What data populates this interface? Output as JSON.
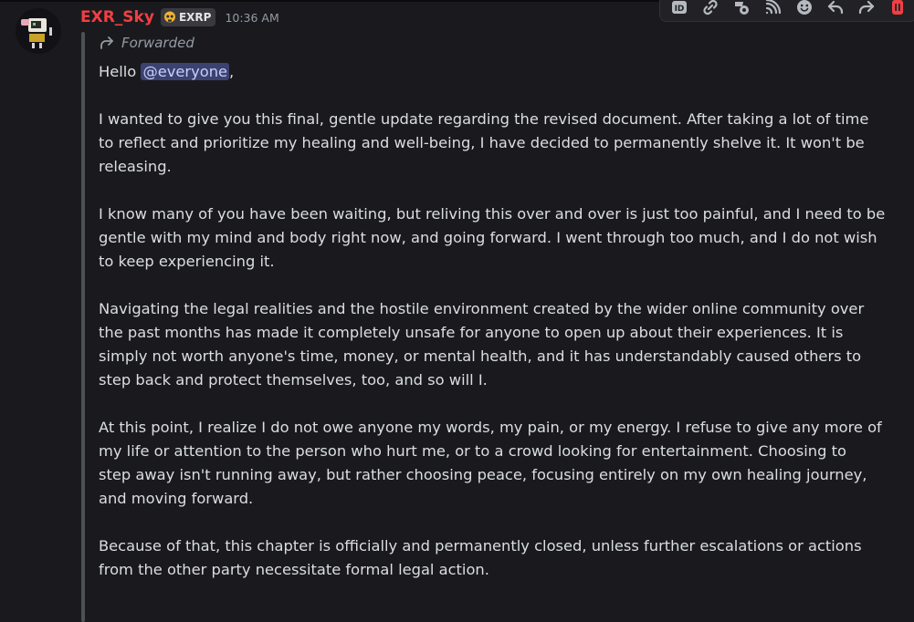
{
  "message": {
    "author": "EXR_Sky",
    "tag": "EXRP",
    "timestamp": "10:36 AM",
    "forwarded_label": "Forwarded",
    "greeting": "Hello ",
    "mention": "@everyone",
    "greeting_end": ",",
    "lines": [
      "",
      "I wanted to give you this final, gentle update regarding the revised document. After taking a lot of time",
      "to reflect and prioritize my healing and well-being, I have decided to permanently shelve it. It won't be",
      "releasing.",
      "",
      "I know many of you have been waiting, but reliving this over and over is just too painful, and I need to be",
      "gentle with my mind and body right now, and going forward. I went through too much, and I do not wish",
      "to keep experiencing it.",
      "",
      "Navigating the legal realities and the hostile environment created by the wider online community over",
      "the past months has made it completely unsafe for anyone to open up about their experiences. It is",
      "simply not worth anyone's time, money, or mental health, and it has understandably caused others to",
      "step back and protect themselves, too, and so will I.",
      "",
      "At this point, I realize I do not owe anyone my words, my pain, or my energy. I refuse to give any more of",
      "my life or attention to the person who hurt me, or to a crowd looking for entertainment. Choosing to",
      "step away isn't running away, but rather choosing peace, focusing entirely on my own healing journey,",
      "and moving forward.",
      "",
      "Because of that, this chapter is officially and permanently closed, unless further escalations or actions",
      "from the other party necessitate formal legal action."
    ]
  },
  "toolbar": {
    "icons": [
      "id-icon",
      "link-icon",
      "forward-shield-icon",
      "rss-icon",
      "add-reaction-icon",
      "reply-icon",
      "forward-icon",
      "delete-icon"
    ],
    "delete_color": "#f23f43"
  },
  "colors": {
    "username": "#f23f43",
    "mention_bg": "#3c4270",
    "mention_text": "#c9cdfb",
    "background": "#1a1a1e"
  }
}
